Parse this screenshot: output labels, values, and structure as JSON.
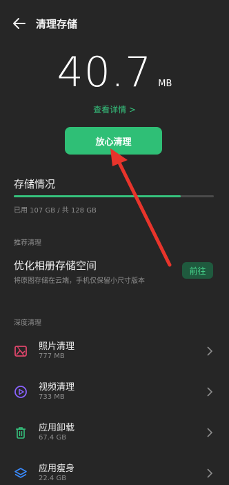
{
  "header": {
    "title": "清理存储"
  },
  "summary": {
    "size": "40.7",
    "unit": "MB",
    "detail_link": "查看详情 >"
  },
  "clean_button": {
    "label": "放心清理"
  },
  "storage": {
    "title": "存储情况",
    "usage_text": "已用 107 GB / 共 128 GB",
    "used_fraction": 0.836
  },
  "recommended": {
    "group_label": "推荐清理",
    "title": "优化相册存储空间",
    "subtitle": "将原图存储在云端，手机仅保留小尺寸版本",
    "action_label": "前往"
  },
  "deep": {
    "group_label": "深度清理",
    "items": [
      {
        "name": "照片清理",
        "size": "777 MB",
        "icon": "photo-icon",
        "color": "#e0466b"
      },
      {
        "name": "视频清理",
        "size": "733 MB",
        "icon": "video-icon",
        "color": "#8a63ff"
      },
      {
        "name": "应用卸载",
        "size": "67.4 GB",
        "icon": "trash-icon",
        "color": "#35c27d"
      },
      {
        "name": "应用瘦身",
        "size": "22.4 GB",
        "icon": "layers-icon",
        "color": "#3a8bff"
      }
    ]
  },
  "colors": {
    "accent": "#35c27d",
    "background": "#262626",
    "annotation_arrow": "#e8342b"
  }
}
